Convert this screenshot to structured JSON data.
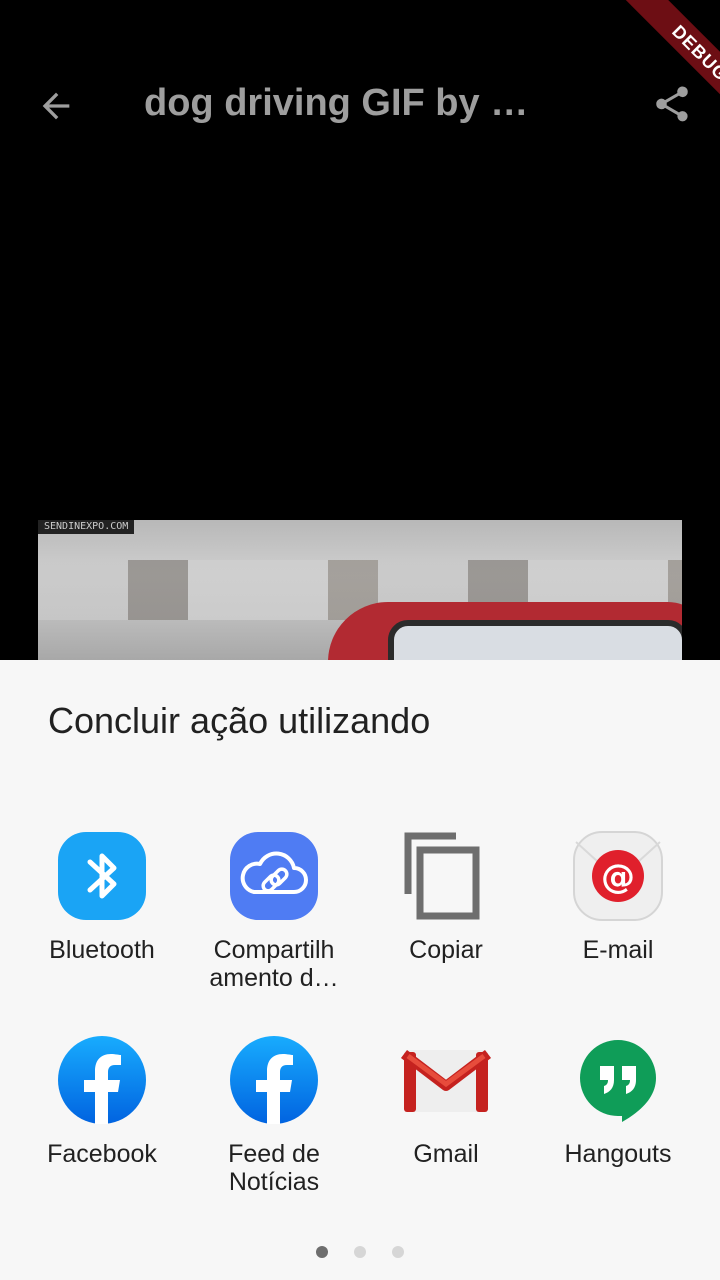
{
  "appbar": {
    "title": "dog driving GIF by …",
    "debug_label": "DEBUG"
  },
  "gif": {
    "watermark": "SENDINEXPO.COM"
  },
  "share_sheet": {
    "title": "Concluir ação utilizando",
    "apps": [
      {
        "label": "Bluetooth",
        "icon": "bluetooth-icon",
        "color": "#1aa4f5"
      },
      {
        "label": "Compartilh\namento d…",
        "icon": "cloud-link-icon",
        "color": "#4f7cf3"
      },
      {
        "label": "Copiar",
        "icon": "copy-icon",
        "color": "#6e6e6e"
      },
      {
        "label": "E-mail",
        "icon": "email-at-icon",
        "color": "#e0202c"
      },
      {
        "label": "Facebook",
        "icon": "facebook-icon",
        "color": "#1877f2"
      },
      {
        "label": "Feed de\nNotícias",
        "icon": "facebook-feed-icon",
        "color": "#1877f2"
      },
      {
        "label": "Gmail",
        "icon": "gmail-icon",
        "color": "#d93025"
      },
      {
        "label": "Hangouts",
        "icon": "hangouts-icon",
        "color": "#0f9d58"
      }
    ],
    "pages": {
      "count": 3,
      "active_index": 0
    }
  }
}
